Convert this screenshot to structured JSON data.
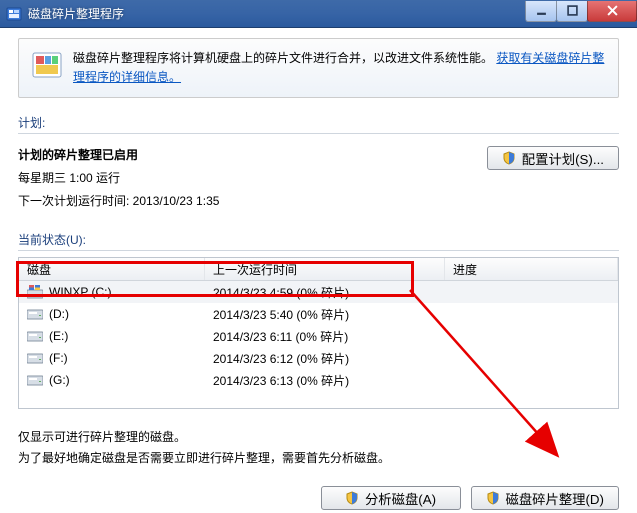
{
  "window": {
    "title": "磁盘碎片整理程序"
  },
  "banner": {
    "text": "磁盘碎片整理程序将计算机硬盘上的碎片文件进行合并，以改进文件系统性能。",
    "link": "获取有关磁盘碎片整理程序的详细信息。"
  },
  "labels": {
    "schedule_section": "计划:",
    "status_section": "当前状态(U):",
    "col_disk": "磁盘",
    "col_lastrun": "上一次运行时间",
    "col_progress": "进度"
  },
  "schedule": {
    "title": "计划的碎片整理已启用",
    "line1": "每星期三   1:00 运行",
    "line2": "下一次计划运行时间: 2013/10/23 1:35",
    "configure_btn": "配置计划(S)..."
  },
  "disks": [
    {
      "name": "WINXP (C:)",
      "lastrun": "2014/3/23 4:59 (0% 碎片)",
      "primary": true
    },
    {
      "name": "(D:)",
      "lastrun": "2014/3/23 5:40 (0% 碎片)",
      "primary": false
    },
    {
      "name": "(E:)",
      "lastrun": "2014/3/23 6:11 (0% 碎片)",
      "primary": false
    },
    {
      "name": "(F:)",
      "lastrun": "2014/3/23 6:12 (0% 碎片)",
      "primary": false
    },
    {
      "name": "(G:)",
      "lastrun": "2014/3/23 6:13 (0% 碎片)",
      "primary": false
    }
  ],
  "footer": {
    "note1": "仅显示可进行碎片整理的磁盘。",
    "note2": "为了最好地确定磁盘是否需要立即进行碎片整理，需要首先分析磁盘。",
    "analyze_btn": "分析磁盘(A)",
    "defrag_btn": "磁盘碎片整理(D)"
  },
  "icons": {
    "shield": "shield-icon",
    "drive": "drive-icon"
  }
}
